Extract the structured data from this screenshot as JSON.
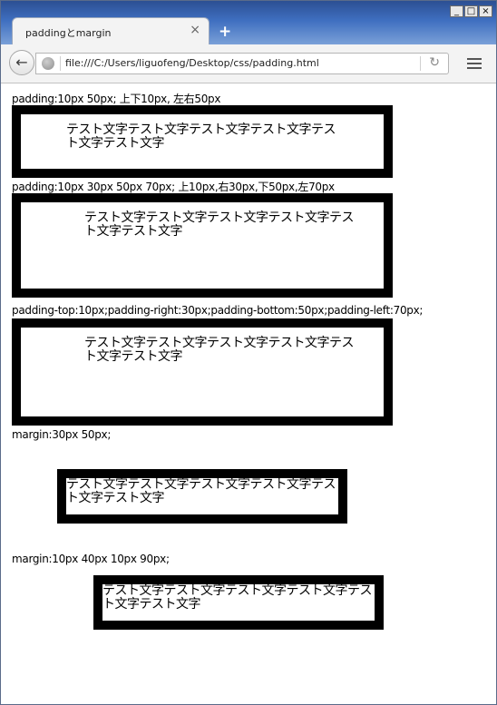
{
  "window": {
    "buttons": [
      "_",
      "□",
      "×"
    ]
  },
  "tab": {
    "title": "paddingとmargin",
    "close": "×",
    "new_tab": "+"
  },
  "nav": {
    "back": "←",
    "url": "file:///C:/Users/liguofeng/Desktop/css/padding.html",
    "reload": "↻",
    "icons": [
      "back-icon",
      "globe-icon",
      "reload-icon",
      "hamburger-menu-icon"
    ]
  },
  "content": {
    "sections": [
      {
        "label": "padding:10px 50px; 上下10px, 左右50px",
        "text": "テスト文字テスト文字テスト文字テスト文字テスト文字テスト文字"
      },
      {
        "label": "padding:10px 30px 50px 70px; 上10px,右30px,下50px,左70px",
        "text": "テスト文字テスト文字テスト文字テスト文字テスト文字テスト文字"
      },
      {
        "label": "padding-top:10px;padding-right:30px;padding-bottom:50px;padding-left:70px;",
        "text": "テスト文字テスト文字テスト文字テスト文字テスト文字テスト文字"
      },
      {
        "label": "margin:30px 50px;",
        "text": "テスト文字テスト文字テスト文字テスト文字テスト文字テスト文字"
      },
      {
        "label": "margin:10px 40px 10px 90px;",
        "text": "テスト文字テスト文字テスト文字テスト文字テスト文字テスト文字"
      }
    ]
  },
  "colors": {
    "titlebar": "#3f6fc0",
    "border": "#000000",
    "background": "#ffffff"
  }
}
